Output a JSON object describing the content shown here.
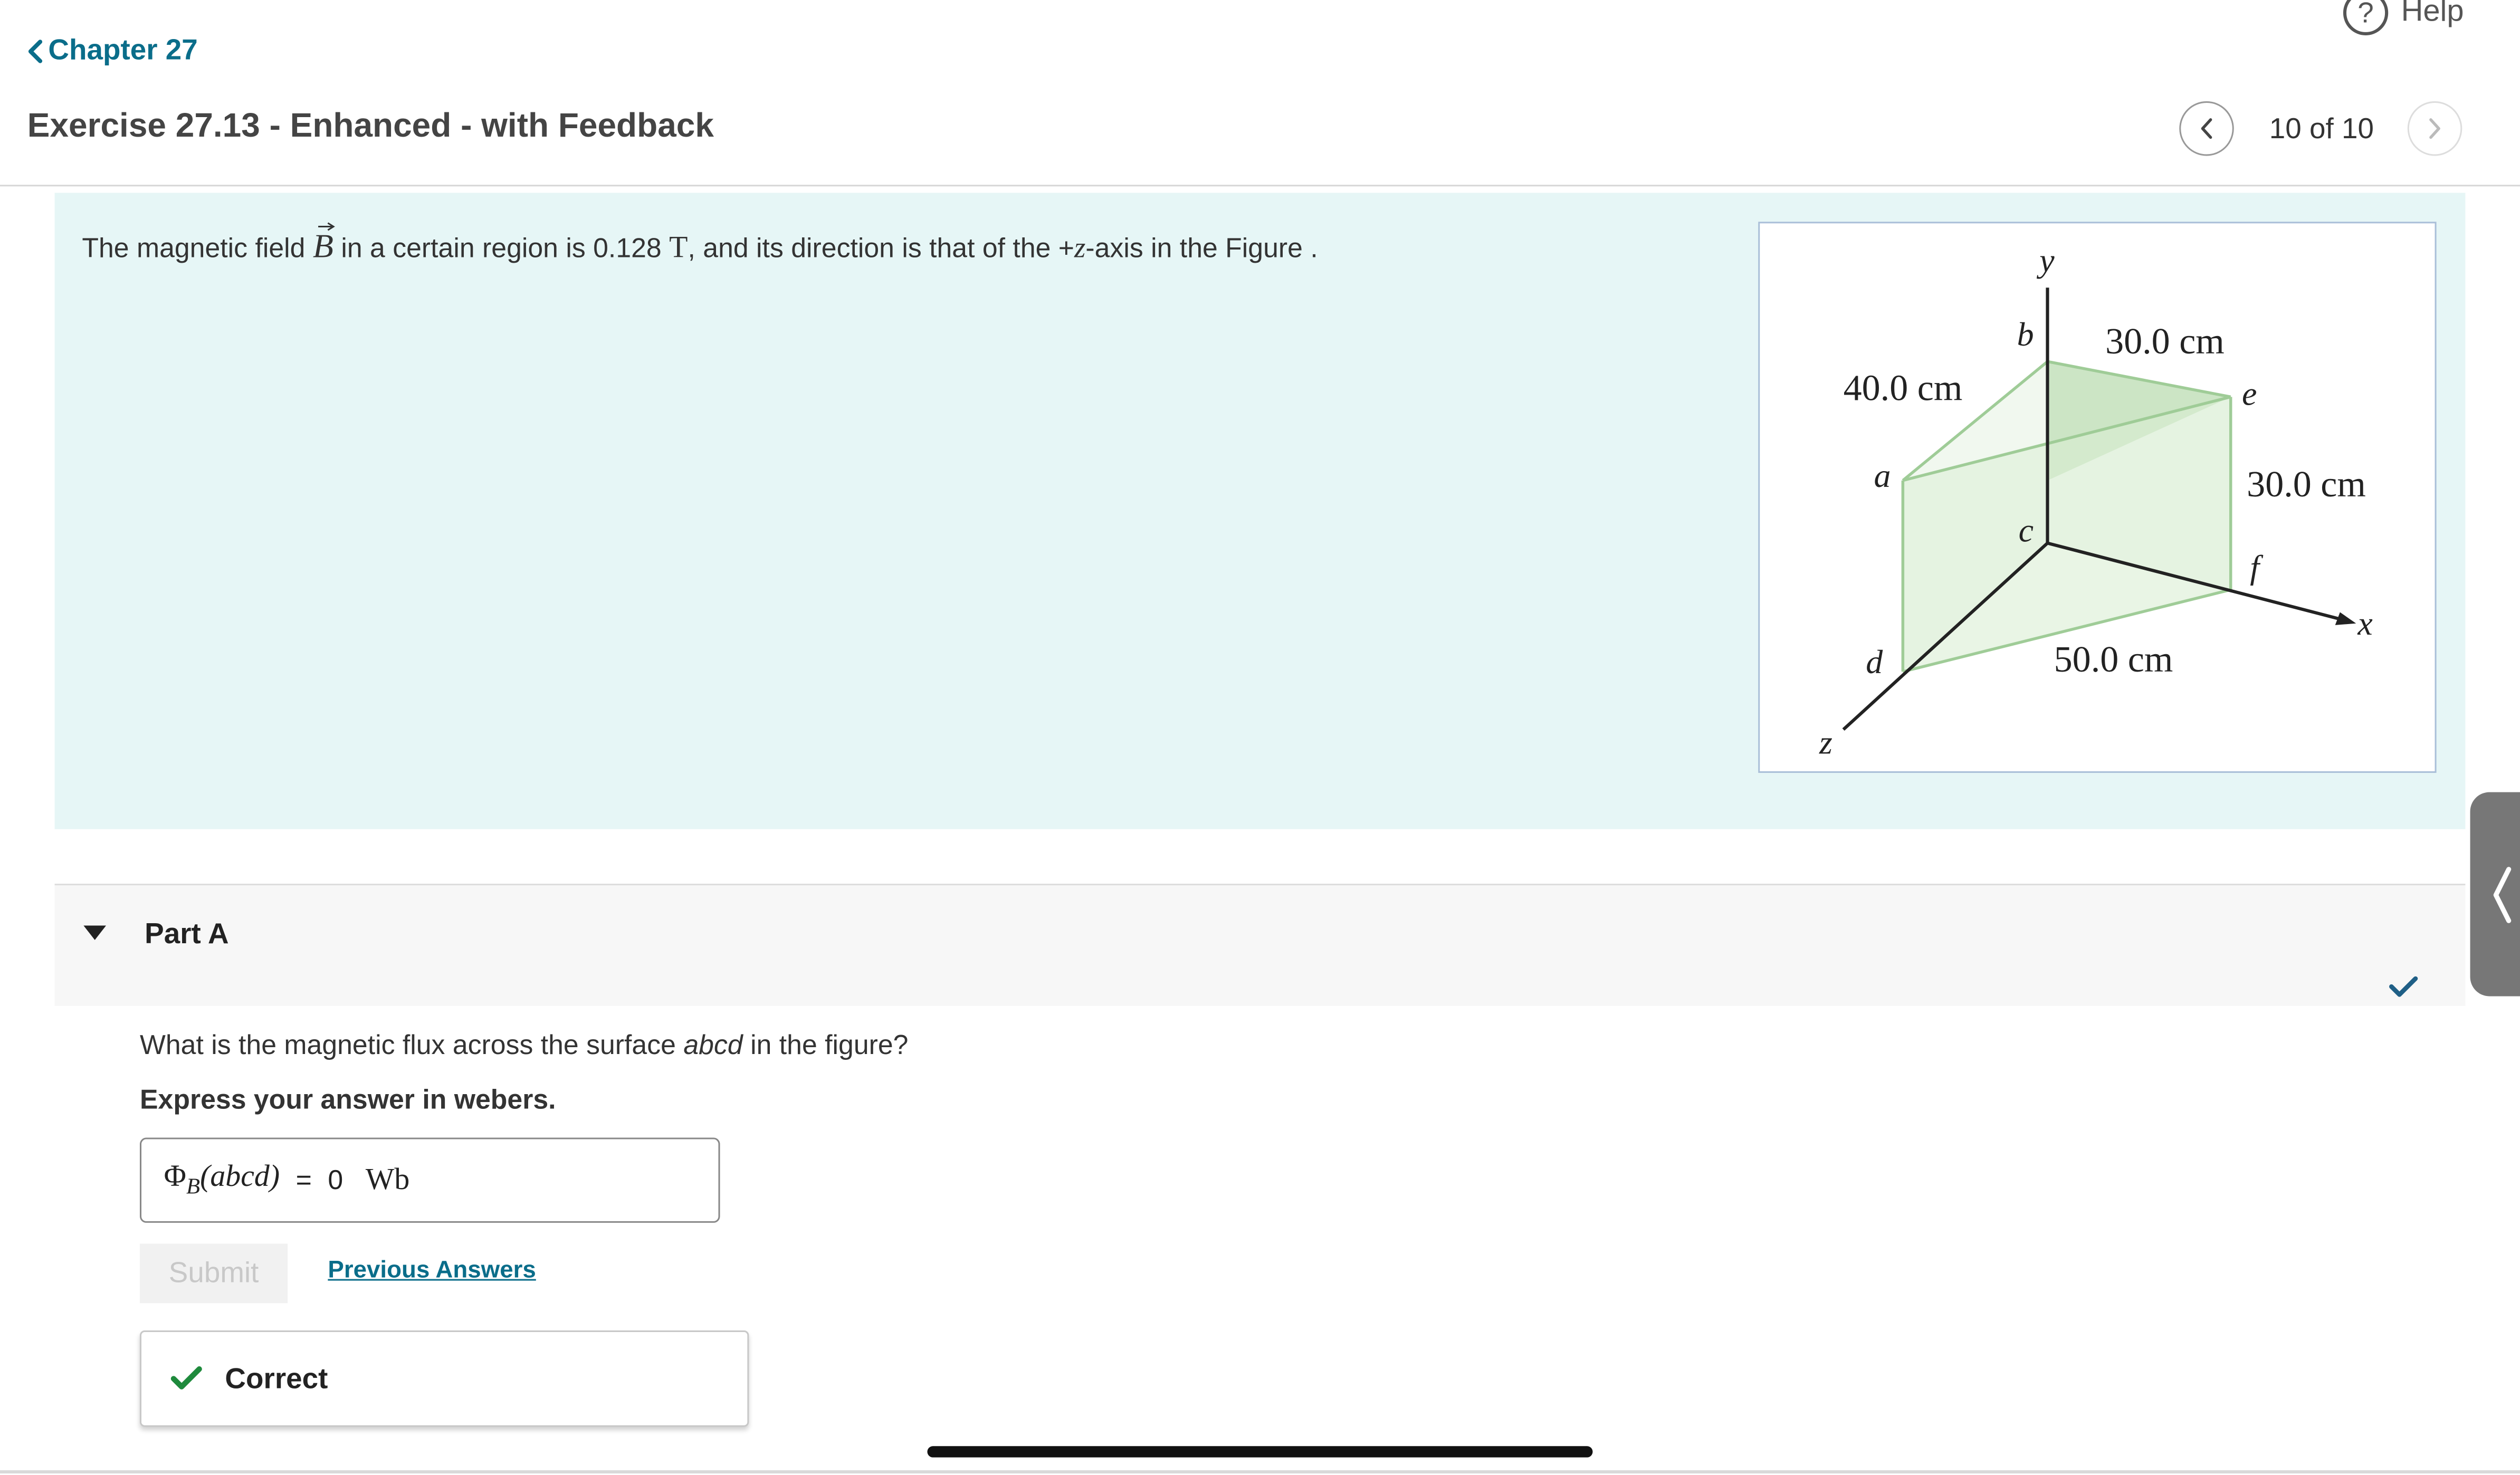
{
  "header": {
    "help_label": "Help",
    "help_icon_glyph": "?",
    "back_label": "Chapter 27",
    "title": "Exercise 27.13 - Enhanced - with Feedback",
    "counter": "10 of 10"
  },
  "problem": {
    "text_part1": "The magnetic field",
    "symbol_B": "B",
    "text_part2": "in a certain region is 0.128",
    "unit_T": "T",
    "text_part3": ", and its direction is that of the +",
    "axis_z": "z",
    "text_part4": "-axis in the Figure ."
  },
  "figure": {
    "labels": {
      "y": "y",
      "b": "b",
      "dim_top": "30.0 cm",
      "dim_left": "40.0 cm",
      "e": "e",
      "a": "a",
      "c": "c",
      "dim_right": "30.0 cm",
      "f": "f",
      "x": "x",
      "d": "d",
      "dim_bottom": "50.0 cm",
      "z": "z"
    },
    "colors": {
      "face_fill": "#b9dcb0",
      "edge": "#9fcc97",
      "axis": "#222222"
    }
  },
  "partA": {
    "title": "Part A",
    "question_pre": "What is the magnetic flux across the surface",
    "question_var": "abcd",
    "question_post": "in the figure?",
    "instruction": "Express your answer in webers.",
    "answer": {
      "lhs_symbol": "Φ",
      "lhs_sub": "B",
      "lhs_arg": "(abcd)",
      "equals": "=",
      "value": "0",
      "unit": "Wb"
    },
    "submit_label": "Submit",
    "previous_answers_label": "Previous Answers",
    "feedback_label": "Correct"
  },
  "colors": {
    "link": "#0a6d8a",
    "problem_bg": "#e6f6f6",
    "correct_green": "#1e8a3c"
  }
}
